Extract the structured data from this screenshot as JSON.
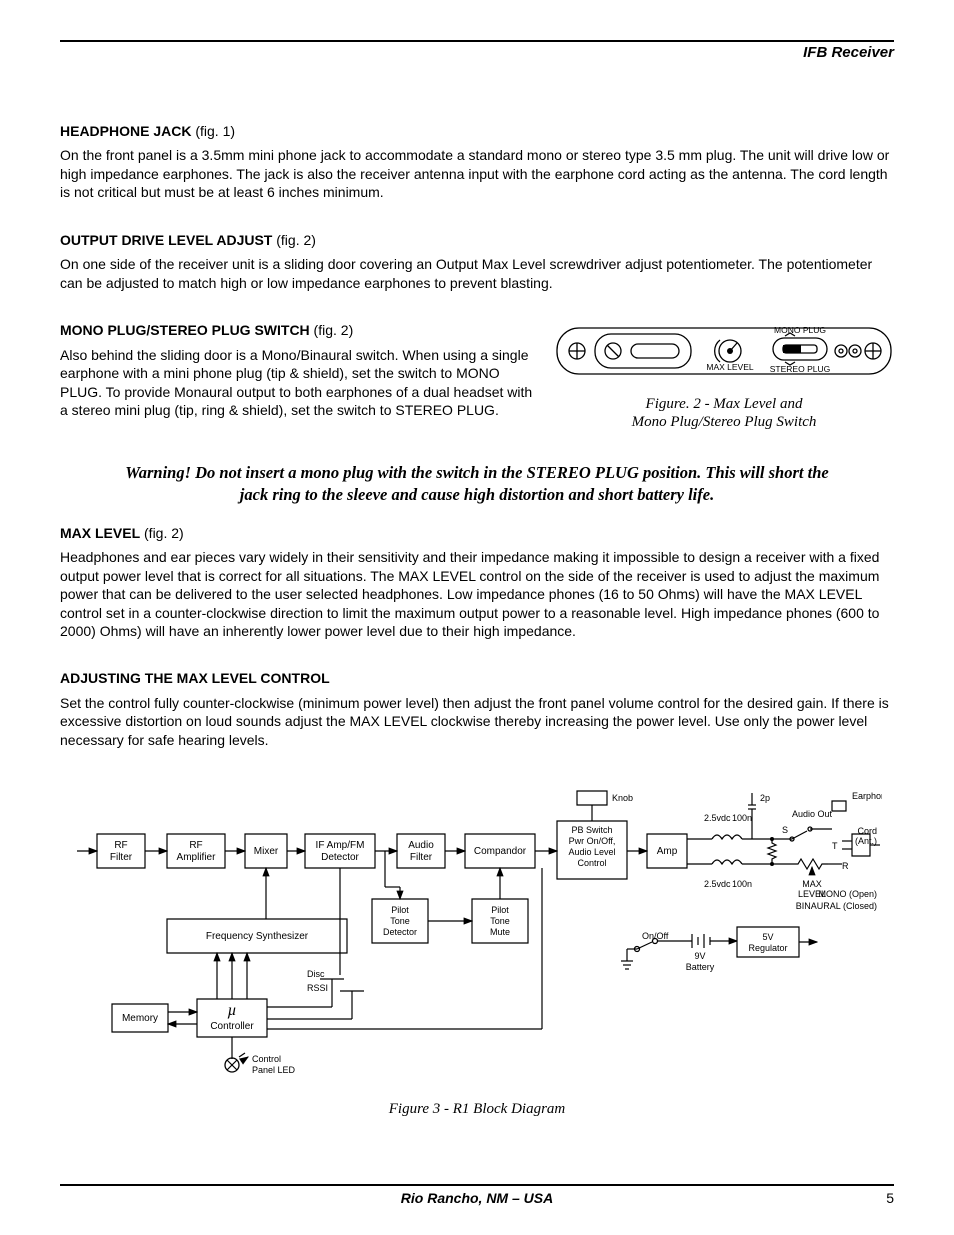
{
  "doc_header": "IFB Receiver",
  "sections": {
    "s1": {
      "title": "HEADPHONE JACK",
      "figref": " (fig. 1)",
      "body": "On the front panel is a 3.5mm mini phone jack to accommodate a standard mono or stereo type 3.5 mm plug.  The unit will drive low or high impedance earphones.  The jack is also the receiver antenna input with the earphone cord acting as the antenna.  The cord length is not critical but must be at least 6 inches minimum."
    },
    "s2": {
      "title": "OUTPUT DRIVE LEVEL ADJUST",
      "figref": " (fig. 2)",
      "body": "On one side of the receiver unit is a sliding door covering an Output Max Level screwdriver adjust potentiometer.  The potentiometer can be adjusted to match high or low impedance earphones to prevent blasting."
    },
    "s3": {
      "title": "MONO PLUG/STEREO PLUG SWITCH",
      "figref": " (fig. 2)",
      "body": "Also behind the sliding door is a Mono/Binaural switch.  When using a single earphone with a mini phone plug (tip & shield), set the switch to MONO PLUG.  To provide Monaural output to both earphones of a dual headset with a stereo mini plug (tip, ring & shield), set the switch to STEREO PLUG."
    },
    "s4": {
      "title": "MAX LEVEL",
      "figref": " (fig. 2)",
      "body": "Headphones and ear pieces vary widely in their sensitivity and their impedance making it impossible to design a receiver with a fixed output power level that is correct for all situations.  The MAX LEVEL control on the side of the receiver is used to adjust the maximum power that can be delivered to the user selected headphones.  Low impedance phones (16 to 50 Ohms) will have the MAX LEVEL control set in a counter-clockwise direction to limit the maximum output power to a reasonable level.  High impedance phones (600 to 2000) Ohms) will have an inherently lower power level due to their high impedance."
    },
    "s5": {
      "title": "ADJUSTING THE MAX LEVEL CONTROL",
      "figref": "",
      "body": "Set the control fully counter-clockwise (minimum power level) then adjust the front panel volume control for the desired gain.  If there is excessive distortion on loud sounds adjust the MAX LEVEL clockwise thereby increasing the power level.  Use only the power level necessary for safe hearing levels."
    }
  },
  "warning": "Warning!   Do not insert a mono plug with the switch in the STEREO PLUG position.   This will short the jack ring to the sleeve and cause high distortion and short battery life.",
  "fig2": {
    "caption_l1": "Figure. 2 - Max Level and",
    "caption_l2": "Mono Plug/Stereo Plug Switch",
    "labels": {
      "mono": "MONO PLUG",
      "stereo": "STEREO PLUG",
      "max": "MAX LEVEL"
    }
  },
  "fig3": {
    "caption": "Figure 3 - R1 Block Diagram",
    "blocks": {
      "rf_filter": "RF\nFilter",
      "rf_amp": "RF\nAmplifier",
      "mixer": "Mixer",
      "if_det": "IF Amp/FM\nDetector",
      "audio_filter": "Audio\nFilter",
      "compandor": "Compandor",
      "pb_switch": "PB Switch\nPwr On/Off,\nAudio Level\nControl",
      "amp": "Amp",
      "freq_syn": "Frequency Synthesizer",
      "pilot_det": "Pilot\nTone\nDetector",
      "pilot_mute": "Pilot\nTone\nMute",
      "memory": "Memory",
      "ucontroller": "µ\nController",
      "reg5v": "5V\nRegulator"
    },
    "labels": {
      "knob": "Knob",
      "twop": "2p",
      "earphone": "Earphone",
      "audio_out": "Audio Out",
      "cord": "Cord\n(Ant.)",
      "s": "S",
      "r": "R",
      "t": "T",
      "v25a": "2.5vdc",
      "v25b": "2.5vdc",
      "c100a": "100n",
      "c100b": "100n",
      "max_level": "MAX\nLEVEL",
      "mono_open": "MONO (Open)",
      "bin_closed": "BINAURAL (Closed)",
      "onoff": "On/Off",
      "batt": "9V\nBattery",
      "disc": "Disc",
      "rssi": "RSSI",
      "cpanel": "Control\nPanel LED"
    }
  },
  "footer": {
    "center": "Rio Rancho, NM – USA",
    "page": "5"
  }
}
